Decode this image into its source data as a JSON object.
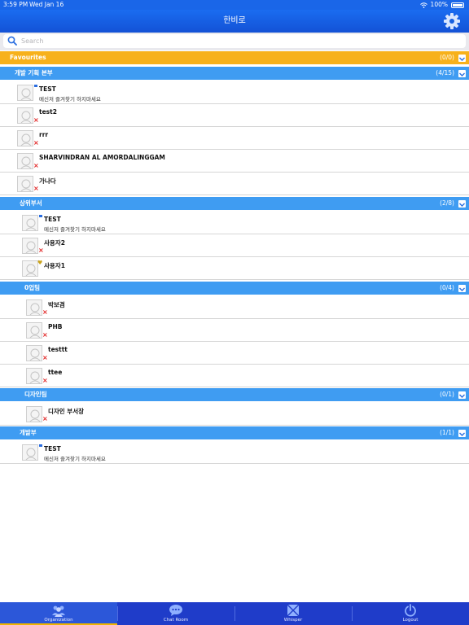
{
  "status_bar": {
    "time": "3:59 PM",
    "date": "Wed Jan 16",
    "battery": "100%"
  },
  "nav": {
    "title": "한비로"
  },
  "search": {
    "placeholder": "Search"
  },
  "favourites": {
    "title": "Favourites",
    "count": "(0/0)"
  },
  "groups": [
    {
      "title": "개발 기획 본부",
      "count": "(4/15)",
      "members": [
        {
          "name": "TEST",
          "message": "메신저 즐겨찾기 하지마세요",
          "status": "online"
        },
        {
          "name": "test2",
          "message": "",
          "status": "offline"
        },
        {
          "name": "rrr",
          "message": "",
          "status": "offline"
        },
        {
          "name": "SHARVINDRAN AL AMORDALINGGAM",
          "message": "",
          "status": "offline"
        },
        {
          "name": "가나다",
          "message": "",
          "status": "offline"
        }
      ]
    },
    {
      "title": "상위부서",
      "count": "(2/8)",
      "members": [
        {
          "name": "TEST",
          "message": "메신저 즐겨찾기 하지마세요",
          "status": "online"
        },
        {
          "name": "사용자2",
          "message": "",
          "status": "offline"
        },
        {
          "name": "사용자1",
          "message": "",
          "status": "heart"
        }
      ]
    },
    {
      "title": "0업팀",
      "count": "(0/4)",
      "members": [
        {
          "name": "박보겸",
          "message": "",
          "status": "offline"
        },
        {
          "name": "PHB",
          "message": "",
          "status": "offline"
        },
        {
          "name": "testtt",
          "message": "",
          "status": "offline"
        },
        {
          "name": "ttee",
          "message": "",
          "status": "offline"
        }
      ]
    },
    {
      "title": "디자인팀",
      "count": "(0/1)",
      "members": [
        {
          "name": "디자인 부서장",
          "message": "",
          "status": "offline"
        }
      ]
    },
    {
      "title": "개발부",
      "count": "(1/1)",
      "members": [
        {
          "name": "TEST",
          "message": "메신저 즐겨찾기 하지마세요",
          "status": "online"
        }
      ]
    }
  ],
  "tabs": [
    {
      "label": "Organization",
      "icon": "organization-icon",
      "active": true
    },
    {
      "label": "Chat Room",
      "icon": "chat-icon",
      "active": false
    },
    {
      "label": "Whisper",
      "icon": "whisper-icon",
      "active": false
    },
    {
      "label": "Logout",
      "icon": "power-icon",
      "active": false
    }
  ],
  "colors": {
    "nav": "#1a6cf0",
    "favourites": "#f7b11b",
    "department": "#3f9cf2",
    "tab_bar": "#1f3cc9",
    "offline_mark": "#e01d1d"
  }
}
